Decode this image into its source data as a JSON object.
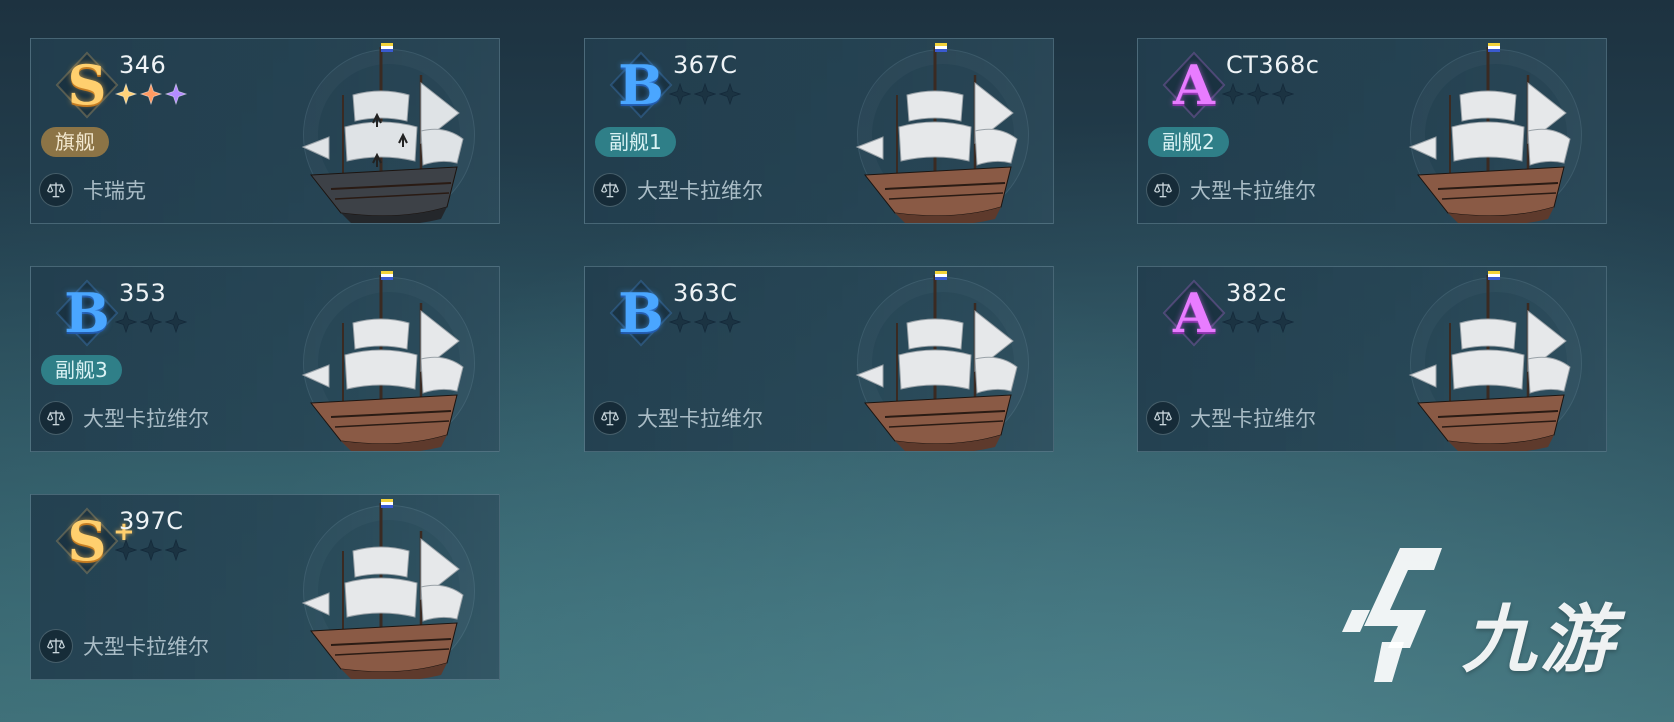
{
  "cards": [
    {
      "grade": "S",
      "grade_plus": "",
      "ship_id": "346",
      "stars": [
        "gold",
        "orange",
        "purple"
      ],
      "role": "旗舰",
      "role_kind": "flag",
      "ship_type": "卡瑞克",
      "hull": "dark"
    },
    {
      "grade": "B",
      "grade_plus": "",
      "ship_id": "367C",
      "stars": [
        "empty",
        "empty",
        "empty"
      ],
      "role": "副舰1",
      "role_kind": "escort",
      "ship_type": "大型卡拉维尔",
      "hull": "wood"
    },
    {
      "grade": "A",
      "grade_plus": "",
      "ship_id": "CT368c",
      "stars": [
        "empty",
        "empty",
        "empty"
      ],
      "role": "副舰2",
      "role_kind": "escort",
      "ship_type": "大型卡拉维尔",
      "hull": "wood"
    },
    {
      "grade": "B",
      "grade_plus": "",
      "ship_id": "353",
      "stars": [
        "empty",
        "empty",
        "empty"
      ],
      "role": "副舰3",
      "role_kind": "escort",
      "ship_type": "大型卡拉维尔",
      "hull": "wood"
    },
    {
      "grade": "B",
      "grade_plus": "",
      "ship_id": "363C",
      "stars": [
        "empty",
        "empty",
        "empty"
      ],
      "role": "",
      "role_kind": "",
      "ship_type": "大型卡拉维尔",
      "hull": "wood"
    },
    {
      "grade": "A",
      "grade_plus": "",
      "ship_id": "382c",
      "stars": [
        "empty",
        "empty",
        "empty"
      ],
      "role": "",
      "role_kind": "",
      "ship_type": "大型卡拉维尔",
      "hull": "wood"
    },
    {
      "grade": "S",
      "grade_plus": "+",
      "ship_id": "397C",
      "stars": [
        "empty",
        "empty",
        "empty"
      ],
      "role": "",
      "role_kind": "",
      "ship_type": "大型卡拉维尔",
      "hull": "wood"
    }
  ],
  "watermark": {
    "text": "九游"
  },
  "colors": {
    "grade_S": "#ffcf6e",
    "grade_B": "#4aa6ff",
    "grade_A": "#e87cff",
    "star_gold": "#ffd27a",
    "star_orange": "#ff9a62",
    "star_purple": "#b48cff",
    "star_empty": "#1b3342",
    "badge_flag": "#8c7446",
    "badge_escort": "#2f7f88"
  }
}
